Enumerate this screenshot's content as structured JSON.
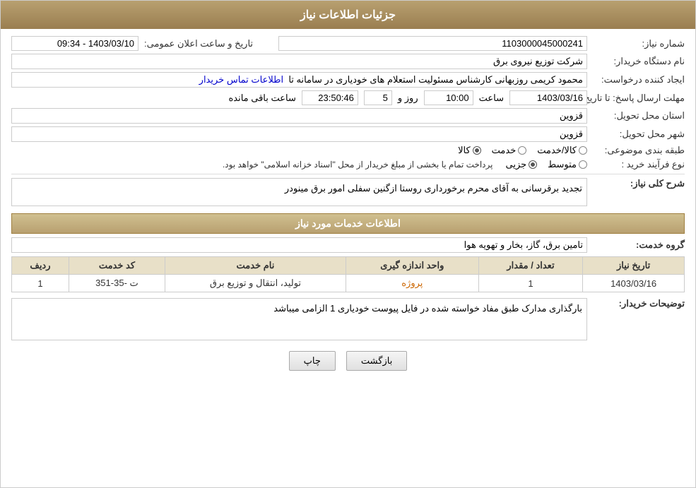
{
  "header": {
    "title": "جزئیات اطلاعات نیاز"
  },
  "fields": {
    "shomara_niaz_label": "شماره نیاز:",
    "shomara_niaz_value": "1103000045000241",
    "nam_dastgah_label": "نام دستگاه خریدار:",
    "nam_dastgah_value": "شرکت توزیع نیروی برق",
    "ijad_konande_label": "ایجاد کننده درخواست:",
    "ijad_konande_value": "محمود کریمی روزبهانی کارشناس  مسئولیت استعلام های خودیاری در سامانه تا",
    "ittila_tamaas": "اطلاعات تماس خریدار",
    "mohlet_ersal_label": "مهلت ارسال پاسخ: تا تاریخ:",
    "tarikh_value": "1403/03/16",
    "saat_label": "ساعت",
    "saat_value": "10:00",
    "roz_label": "روز و",
    "roz_value": "5",
    "remaining_label": "ساعت باقی مانده",
    "remaining_value": "23:50:46",
    "ostan_label": "استان محل تحویل:",
    "ostan_value": "قزوین",
    "shahr_label": "شهر محل تحویل:",
    "shahr_value": "قزوین",
    "tabaqe_label": "طبقه بندی موضوعی:",
    "tabaqe_kala": "کالا",
    "tabaqe_khadamat": "خدمت",
    "tabaqe_kala_khadamat": "کالا/خدمت",
    "nav_farayand_label": "نوع فرآیند خرید :",
    "nav_jozi": "جزیی",
    "nav_motavaset": "متوسط",
    "nav_description": "پرداخت تمام یا بخشی از مبلغ خریدار از محل \"اسناد خزانه اسلامی\" خواهد بود.",
    "tarikh_elaan_label": "تاریخ و ساعت اعلان عمومی:",
    "tarikh_elaan_value": "1403/03/10 - 09:34",
    "sharh_section": "اطلاعات خدمات مورد نیاز",
    "sharh_label": "شرح کلی نیاز:",
    "sharh_value": "تجدید برقرسانی به آقای محرم برخورداری روستا ازگنین سفلی امور برق مینودر",
    "gorohe_khadamat_label": "گروه خدمت:",
    "gorohe_khadamat_value": "تامین برق، گاز، بخار و تهویه هوا",
    "table_headers": {
      "radif": "ردیف",
      "code_khadamat": "کد خدمت",
      "name_khadamat": "نام خدمت",
      "vahed": "واحد اندازه گیری",
      "tedad": "تعداد / مقدار",
      "tarikh": "تاریخ نیاز"
    },
    "table_rows": [
      {
        "radif": "1",
        "code_khadamat": "ت -35-351",
        "name_khadamat": "تولید، انتقال و توزیع برق",
        "vahed": "پروژه",
        "tedad": "1",
        "tarikh": "1403/03/16"
      }
    ],
    "tosihhat_label": "توضیحات خریدار:",
    "tosihhat_value": "بارگذاری مدارک طبق مفاد خواسته شده در فایل پیوست خودیاری 1 الزامی میباشد",
    "btn_print": "چاپ",
    "btn_back": "بازگشت"
  }
}
